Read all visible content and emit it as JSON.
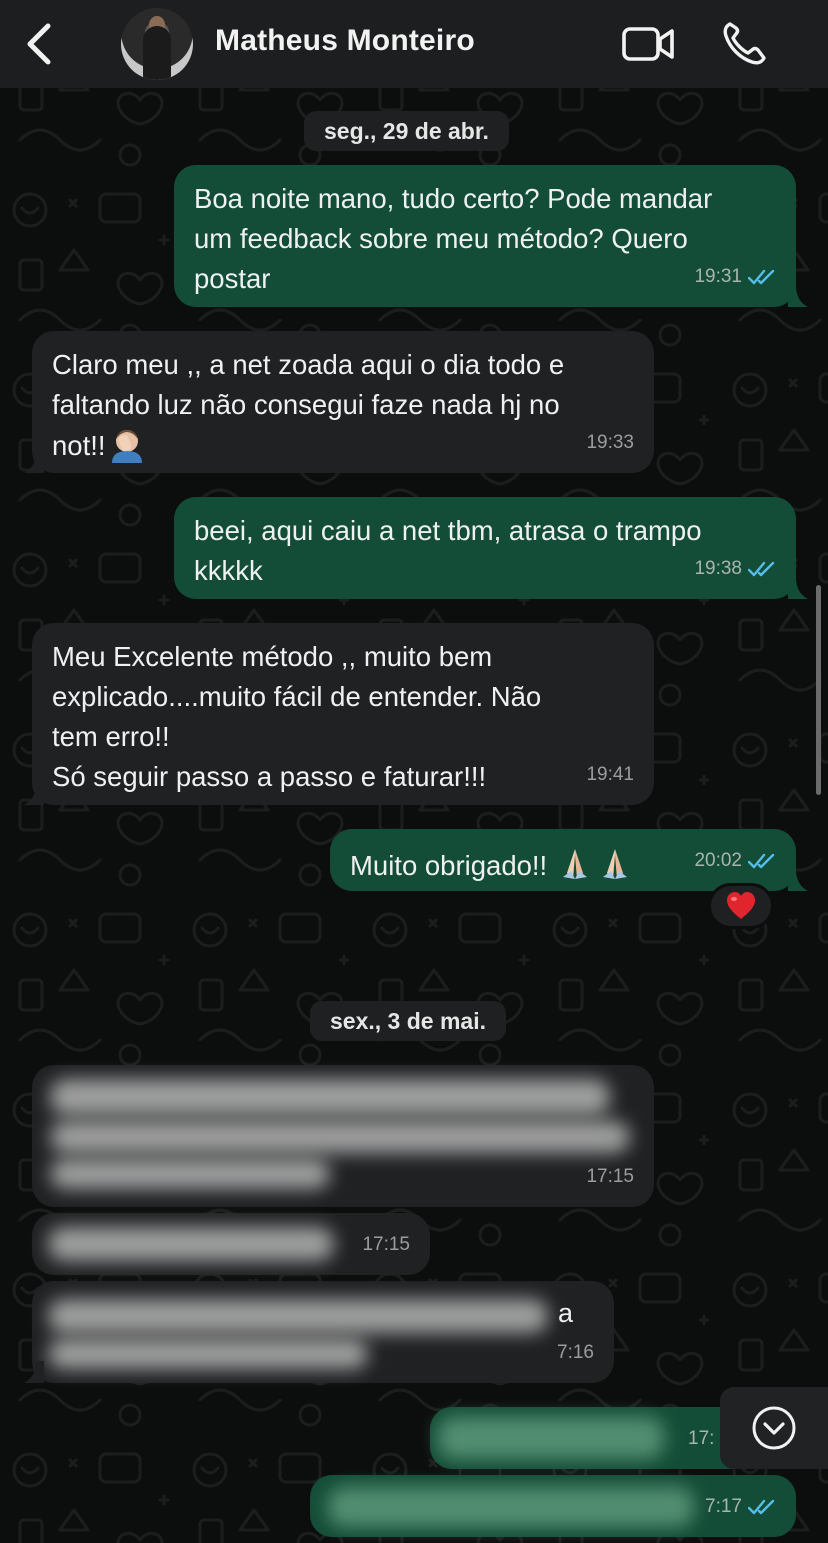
{
  "header": {
    "contact_name": "Matheus Monteiro",
    "icons": [
      "back-chevron-icon",
      "video-call-icon",
      "phone-icon"
    ]
  },
  "colors": {
    "header_bg": "#1c1e1f",
    "outgoing_bubble": "#144d37",
    "incoming_bubble": "#1f2122",
    "read_ticks": "#53bdeb",
    "chat_bg": "#0c0d0d"
  },
  "date_separators": [
    "seg., 29 de abr.",
    "sex., 3 de mai."
  ],
  "messages": [
    {
      "direction": "out",
      "lines": [
        "Boa noite mano, tudo certo? Pode mandar",
        "um feedback sobre meu método? Quero",
        "postar"
      ],
      "time": "19:31",
      "status": "read"
    },
    {
      "direction": "in",
      "lines": [
        "Claro meu ,, a net zoada aqui o dia todo  e",
        "faltando luz não consegui faze nada hj no",
        "not!!"
      ],
      "emoji": "man-facepalming",
      "time": "19:33"
    },
    {
      "direction": "out",
      "lines": [
        "beei, aqui caiu a net tbm, atrasa o trampo",
        "kkkkk"
      ],
      "time": "19:38",
      "status": "read"
    },
    {
      "direction": "in",
      "lines": [
        "Meu Excelente  método  ,, muito bem",
        "explicado....muito fácil de entender. Não",
        "tem erro!!",
        "Só seguir passo a passo e faturar!!!"
      ],
      "time": "19:41"
    },
    {
      "direction": "out",
      "lines": [
        "Muito obrigado!!"
      ],
      "emoji": "folded-hands x2",
      "time": "20:02",
      "status": "read",
      "reaction": "red-heart"
    },
    {
      "direction": "in",
      "blurred": true,
      "time": "17:15"
    },
    {
      "direction": "in",
      "blurred": true,
      "time": "17:15"
    },
    {
      "direction": "in",
      "blurred": true,
      "visible_text_fragment": "a",
      "time_fragment": "7:16"
    },
    {
      "direction": "out",
      "blurred": true,
      "time_fragment": "17:"
    },
    {
      "direction": "out",
      "blurred": true,
      "time_fragment": "7:17",
      "status": "read"
    }
  ]
}
